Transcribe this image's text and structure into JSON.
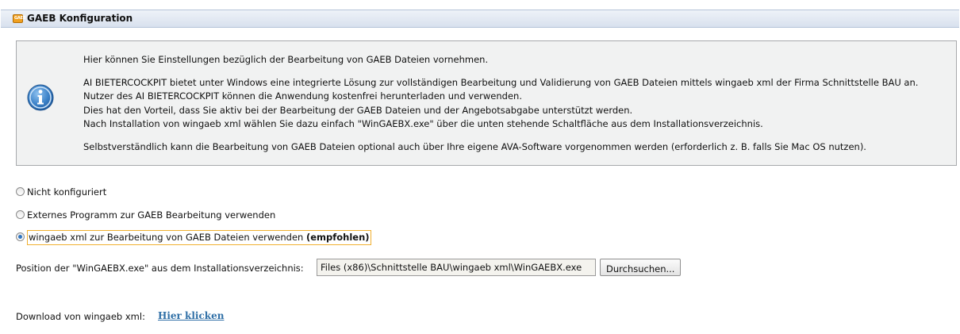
{
  "header": {
    "icon_text": "GAEB",
    "title": "GAEB Konfiguration"
  },
  "info": {
    "icon": "info-icon",
    "lines": [
      "Hier können Sie Einstellungen bezüglich der Bearbeitung von GAEB Dateien vornehmen.",
      "AI BIETERCOCKPIT bietet unter Windows eine integrierte Lösung zur vollständigen Bearbeitung und Validierung von GAEB Dateien mittels wingaeb xml der Firma Schnittstelle BAU an.",
      "Nutzer des AI BIETERCOCKPIT können die Anwendung kostenfrei herunterladen und verwenden.",
      "Dies hat den Vorteil, dass Sie aktiv bei der Bearbeitung der GAEB Dateien und der Angebotsabgabe unterstützt werden.",
      "Nach Installation von wingaeb xml wählen Sie dazu einfach \"WinGAEBX.exe\" über die unten stehende Schaltfläche aus dem Installationsverzeichnis.",
      "Selbstverständlich kann die Bearbeitung von GAEB Dateien optional auch über Ihre eigene AVA-Software vorgenommen werden (erforderlich z. B. falls Sie Mac OS nutzen)."
    ]
  },
  "options": [
    {
      "label": "Nicht konfiguriert",
      "checked": false
    },
    {
      "label": "Externes Programm zur GAEB Bearbeitung verwenden",
      "checked": false
    },
    {
      "label": "wingaeb xml zur Bearbeitung von GAEB Dateien verwenden",
      "suffix": "(empfohlen)",
      "checked": true
    }
  ],
  "position": {
    "label": "Position der \"WinGAEBX.exe\" aus dem Installationsverzeichnis:",
    "value": "Files (x86)\\Schnittstelle BAU\\wingaeb xml\\WinGAEBX.exe",
    "button": "Durchsuchen..."
  },
  "download": {
    "label": "Download von wingaeb xml:",
    "link": "Hier klicken"
  },
  "colors": {
    "header_bg": "#dfe6f1",
    "info_bg": "#f1f2f2",
    "accent_orange": "#f0b030",
    "link": "#2f6fa6",
    "radio_dot": "#2f74c0"
  }
}
